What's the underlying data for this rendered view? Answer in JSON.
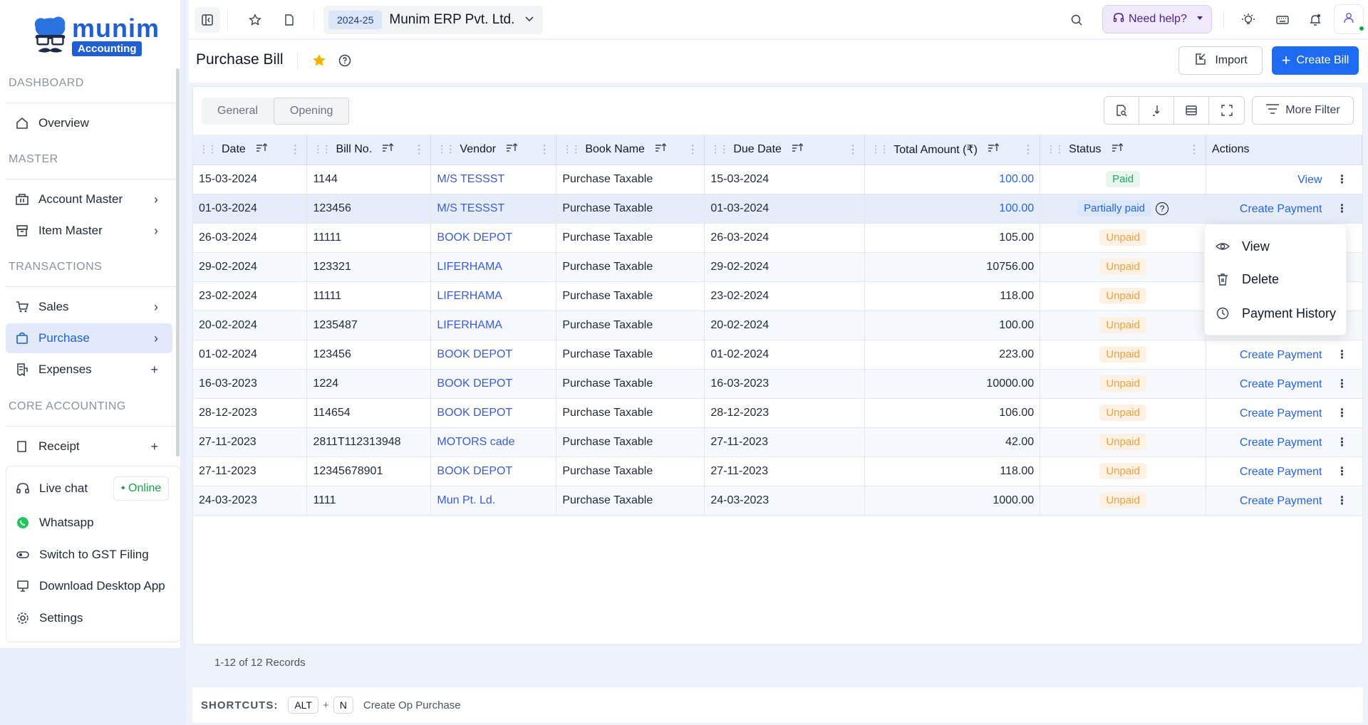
{
  "brand": {
    "name": "munim",
    "sub": "Accounting"
  },
  "sidebar": {
    "sections": {
      "dashboard": "DASHBOARD",
      "master": "MASTER",
      "transactions": "TRANSACTIONS",
      "core": "CORE ACCOUNTING"
    },
    "items": {
      "overview": "Overview",
      "account_master": "Account Master",
      "item_master": "Item Master",
      "sales": "Sales",
      "purchase": "Purchase",
      "expenses": "Expenses",
      "receipt": "Receipt"
    },
    "bottom": {
      "live_chat": "Live chat",
      "online": "• Online",
      "whatsapp": "Whatsapp",
      "switch_gst": "Switch to GST Filing",
      "download": "Download Desktop App",
      "settings": "Settings"
    }
  },
  "topbar": {
    "fy": "2024-25",
    "company": "Munim ERP Pvt. Ltd.",
    "need_help": "Need help?"
  },
  "page": {
    "title": "Purchase Bill",
    "import_label": "Import",
    "create_label": "Create Bill"
  },
  "tabs": {
    "general": "General",
    "opening": "Opening"
  },
  "more_filter": "More Filter",
  "table": {
    "headers": {
      "date": "Date",
      "bill": "Bill No.",
      "vendor": "Vendor",
      "book": "Book Name",
      "due": "Due Date",
      "total": "Total Amount (₹)",
      "status": "Status",
      "actions": "Actions"
    },
    "rows": [
      {
        "date": "15-03-2024",
        "bill": "1144",
        "vendor": "M/S TESSST",
        "book": "Purchase Taxable",
        "due": "15-03-2024",
        "total": "100.00",
        "status": "Paid",
        "action": "View"
      },
      {
        "date": "01-03-2024",
        "bill": "123456",
        "vendor": "M/S TESSST",
        "book": "Purchase Taxable",
        "due": "01-03-2024",
        "total": "100.00",
        "status": "Partially paid",
        "action": "Create Payment"
      },
      {
        "date": "26-03-2024",
        "bill": "11111",
        "vendor": "BOOK DEPOT",
        "book": "Purchase Taxable",
        "due": "26-03-2024",
        "total": "105.00",
        "status": "Unpaid",
        "action": ""
      },
      {
        "date": "29-02-2024",
        "bill": "123321",
        "vendor": "LIFERHAMA",
        "book": "Purchase Taxable",
        "due": "29-02-2024",
        "total": "10756.00",
        "status": "Unpaid",
        "action": ""
      },
      {
        "date": "23-02-2024",
        "bill": "11111",
        "vendor": "LIFERHAMA",
        "book": "Purchase Taxable",
        "due": "23-02-2024",
        "total": "118.00",
        "status": "Unpaid",
        "action": ""
      },
      {
        "date": "20-02-2024",
        "bill": "1235487",
        "vendor": "LIFERHAMA",
        "book": "Purchase Taxable",
        "due": "20-02-2024",
        "total": "100.00",
        "status": "Unpaid",
        "action": ""
      },
      {
        "date": "01-02-2024",
        "bill": "123456",
        "vendor": "BOOK DEPOT",
        "book": "Purchase Taxable",
        "due": "01-02-2024",
        "total": "223.00",
        "status": "Unpaid",
        "action": "Create Payment"
      },
      {
        "date": "16-03-2023",
        "bill": "1224",
        "vendor": "BOOK DEPOT",
        "book": "Purchase Taxable",
        "due": "16-03-2023",
        "total": "10000.00",
        "status": "Unpaid",
        "action": "Create Payment"
      },
      {
        "date": "28-12-2023",
        "bill": "114654",
        "vendor": "BOOK DEPOT",
        "book": "Purchase Taxable",
        "due": "28-12-2023",
        "total": "106.00",
        "status": "Unpaid",
        "action": "Create Payment"
      },
      {
        "date": "27-11-2023",
        "bill": "2811T112313948",
        "vendor": "MOTORS cade",
        "book": "Purchase Taxable",
        "due": "27-11-2023",
        "total": "42.00",
        "status": "Unpaid",
        "action": "Create Payment"
      },
      {
        "date": "27-11-2023",
        "bill": "12345678901",
        "vendor": "BOOK DEPOT",
        "book": "Purchase Taxable",
        "due": "27-11-2023",
        "total": "118.00",
        "status": "Unpaid",
        "action": "Create Payment"
      },
      {
        "date": "24-03-2023",
        "bill": "1111",
        "vendor": "Mun Pt. Ld.",
        "book": "Purchase Taxable",
        "due": "24-03-2023",
        "total": "1000.00",
        "status": "Unpaid",
        "action": "Create Payment"
      }
    ]
  },
  "records": "1-12 of 12 Records",
  "context_menu": {
    "view": "View",
    "delete": "Delete",
    "history": "Payment History"
  },
  "shortcuts": {
    "label": "SHORTCUTS:",
    "key1": "ALT",
    "plus": "+",
    "key2": "N",
    "desc": "Create Op Purchase"
  },
  "colors": {
    "accent": "#1d6bf3",
    "brand": "#1f5fd1",
    "paid": "#22a55a",
    "unpaid": "#f0a040",
    "link": "#2563eb"
  }
}
